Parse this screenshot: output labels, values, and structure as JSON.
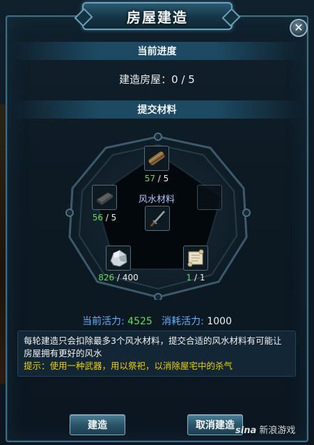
{
  "window": {
    "title": "房屋建造",
    "close_symbol": "✕"
  },
  "progress_section": {
    "header": "当前进度",
    "label": "建造房屋：",
    "current": "0",
    "separator": " / ",
    "total": "5"
  },
  "materials_section": {
    "header": "提交材料",
    "center_label": "风水材料",
    "slots": [
      {
        "icon": "bamboo-scroll-icon",
        "have": "57",
        "need": "/ 5"
      },
      {
        "icon": "empty-slot",
        "have": "",
        "need": ""
      },
      {
        "icon": "iron-ingot-icon",
        "have": "56",
        "need": "/ 5"
      },
      {
        "icon": "sword-icon",
        "have": "",
        "need": ""
      },
      {
        "icon": "ore-rock-icon",
        "have": "826",
        "need": "/ 400"
      },
      {
        "icon": "paper-scroll-icon",
        "have": "1",
        "need": "/ 1"
      }
    ]
  },
  "stats": {
    "current_vitality_label": "当前活力:",
    "current_vitality_value": "4525",
    "cost_vitality_label": "消耗活力:",
    "cost_vitality_value": "1000"
  },
  "info": {
    "description": "每轮建造只会扣除最多3个风水材料，提交合适的风水材料有可能让房屋拥有更好的风水",
    "tip": "提示：使用一种武器，用以祭祀，以消除屋宅中的杀气"
  },
  "buttons": {
    "build": "建造",
    "cancel": "取消建造"
  },
  "watermark": {
    "brand": "sina",
    "text": "新浪游戏"
  },
  "colors": {
    "accent_blue": "#5fb2ff",
    "have_green": "#5ee05e",
    "tip_yellow": "#f0d000",
    "frame_border": "#3f6f86"
  }
}
